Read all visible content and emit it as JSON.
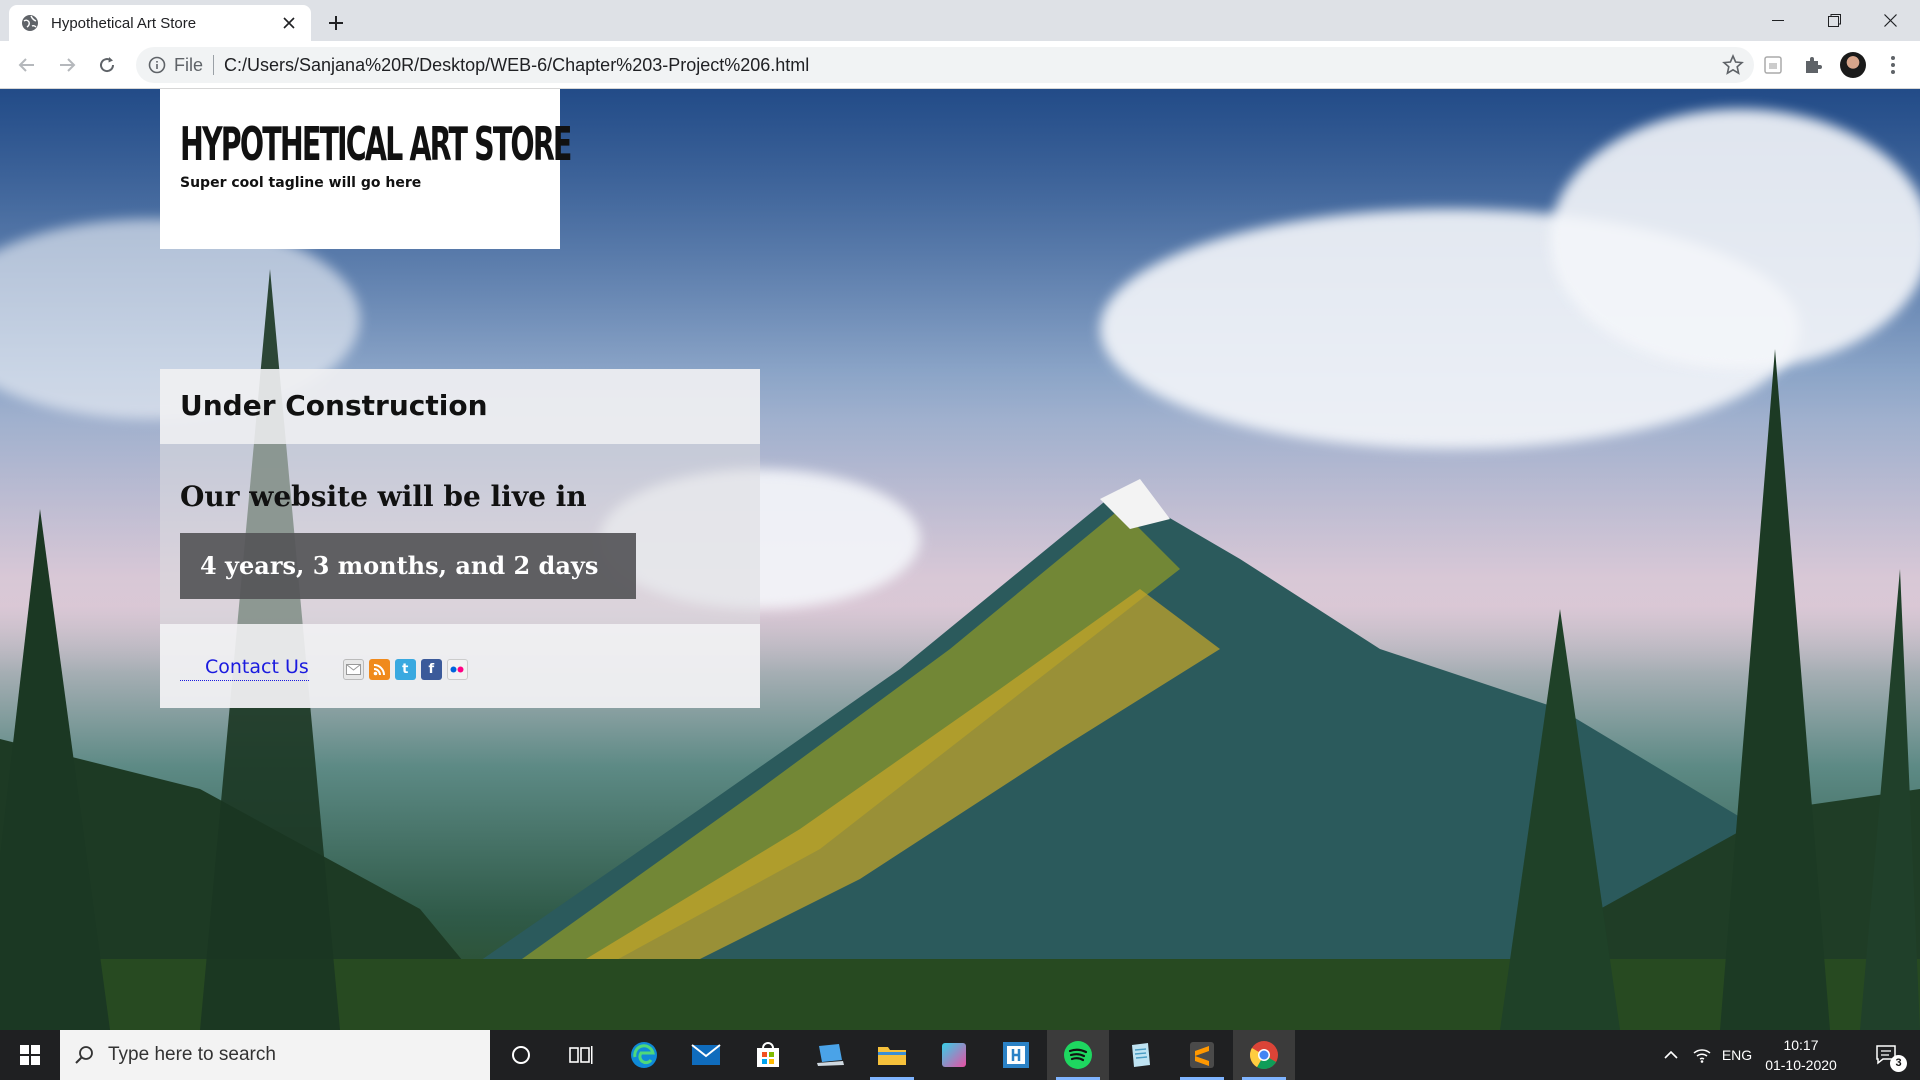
{
  "browser": {
    "tab_title": "Hypothetical Art Store",
    "url_scheme": "File",
    "url": "C:/Users/Sanjana%20R/Desktop/WEB-6/Chapter%203-Project%206.html"
  },
  "page": {
    "logo": "Hypothetical Art Store",
    "tagline": "Super cool tagline will go here",
    "panel_heading": "Under Construction",
    "live_in": "Our website will be live in",
    "countdown": "4 years, 3 months, and 2 days",
    "contact_link": "Contact Us",
    "social_icons": [
      "mail-icon",
      "rss-icon",
      "twitter-icon",
      "facebook-icon",
      "flickr-icon"
    ]
  },
  "taskbar": {
    "search_placeholder": "Type here to search",
    "apps": [
      "cortana",
      "task-view",
      "edge",
      "mail",
      "store",
      "laptop",
      "file-explorer",
      "app",
      "frame-app",
      "spotify",
      "notepad",
      "sublime-text",
      "chrome"
    ],
    "language": "ENG",
    "time": "10:17",
    "date": "01-10-2020",
    "notification_count": "3"
  },
  "colors": {
    "link": "#1a1adf",
    "countdown_bg": "#555558",
    "taskbar_bg": "#1f2022"
  }
}
